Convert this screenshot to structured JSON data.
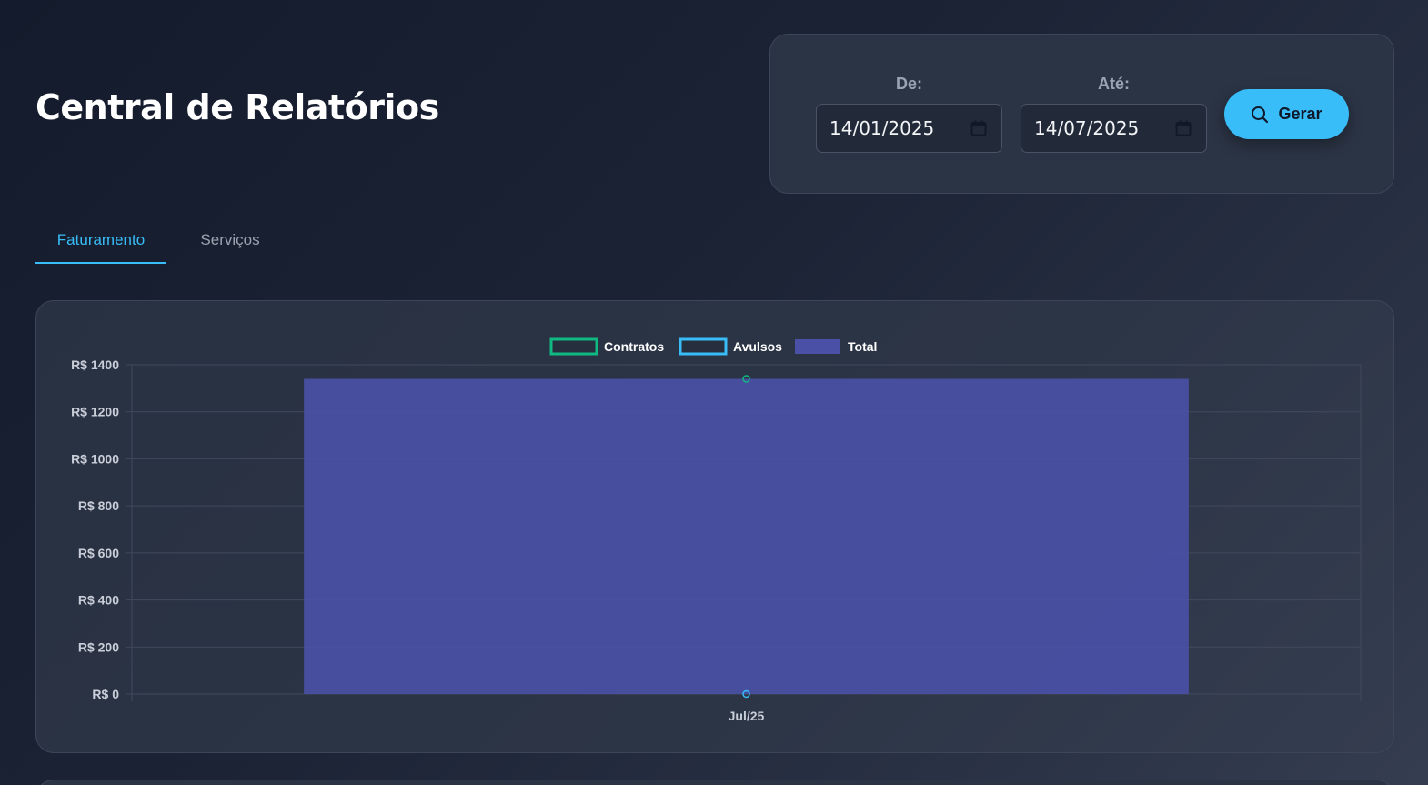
{
  "header": {
    "title": "Central de Relatórios"
  },
  "filters": {
    "from_label": "De:",
    "from_value": "14/01/2025",
    "to_label": "Até:",
    "to_value": "14/07/2025",
    "generate_label": "Gerar",
    "generate_icon": "search-icon",
    "date_icon": "calendar-icon"
  },
  "tabs": [
    {
      "label": "Faturamento",
      "active": true
    },
    {
      "label": "Serviços",
      "active": false
    }
  ],
  "colors": {
    "accent": "#38bdf8",
    "contratos": "#10b981",
    "avulsos": "#38bdf8",
    "total": "#4a50a6"
  },
  "chart_data": {
    "type": "bar",
    "categories": [
      "Jul/25"
    ],
    "series": [
      {
        "name": "Contratos",
        "type": "line",
        "values": [
          1340
        ]
      },
      {
        "name": "Avulsos",
        "type": "line",
        "values": [
          0
        ]
      },
      {
        "name": "Total",
        "type": "bar",
        "values": [
          1340
        ]
      }
    ],
    "ylim": [
      0,
      1400
    ],
    "yticks": [
      "R$ 0",
      "R$ 200",
      "R$ 400",
      "R$ 600",
      "R$ 800",
      "R$ 1000",
      "R$ 1200",
      "R$ 1400"
    ],
    "ytick_values": [
      0,
      200,
      400,
      600,
      800,
      1000,
      1200,
      1400
    ],
    "grid": true,
    "legend": "top-center"
  }
}
